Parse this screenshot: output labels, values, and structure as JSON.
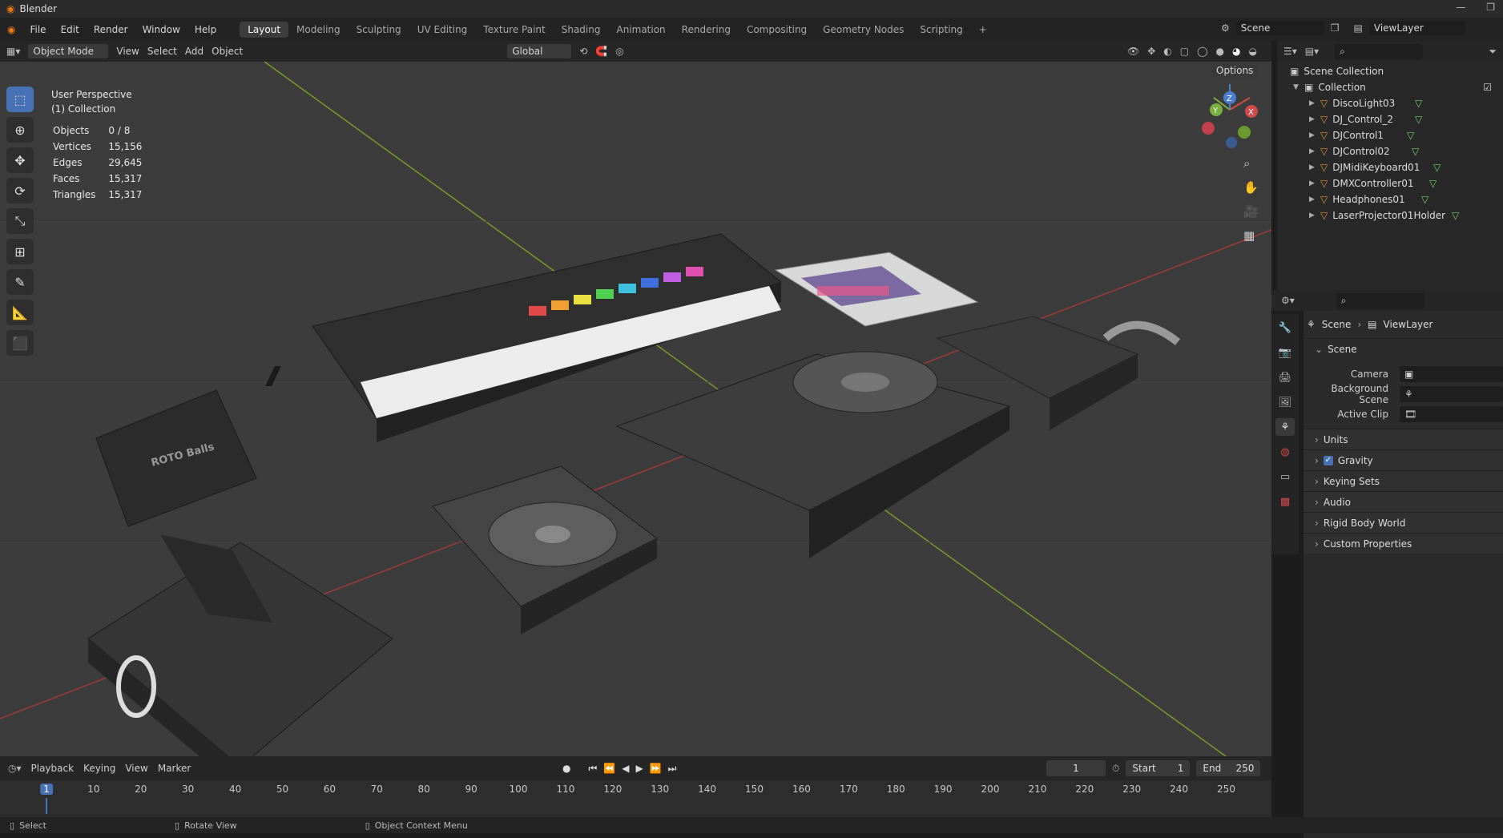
{
  "window": {
    "title": "Blender"
  },
  "menu": [
    "File",
    "Edit",
    "Render",
    "Window",
    "Help"
  ],
  "workspaces": [
    "Layout",
    "Modeling",
    "Sculpting",
    "UV Editing",
    "Texture Paint",
    "Shading",
    "Animation",
    "Rendering",
    "Compositing",
    "Geometry Nodes",
    "Scripting"
  ],
  "active_workspace": "Layout",
  "scene_field": "Scene",
  "viewlayer_field": "ViewLayer",
  "viewport_header": {
    "mode": "Object Mode",
    "view": "View",
    "select": "Select",
    "add": "Add",
    "object": "Object",
    "orientation": "Global",
    "options": "Options"
  },
  "overlay": {
    "perspective": "User Perspective",
    "collection": "(1) Collection"
  },
  "stats": [
    {
      "label": "Objects",
      "value": "0 / 8"
    },
    {
      "label": "Vertices",
      "value": "15,156"
    },
    {
      "label": "Edges",
      "value": "29,645"
    },
    {
      "label": "Faces",
      "value": "15,317"
    },
    {
      "label": "Triangles",
      "value": "15,317"
    }
  ],
  "scene_label": "ROTO Balls",
  "outliner": {
    "scene_collection": "Scene Collection",
    "collection": "Collection",
    "items": [
      "DiscoLight03",
      "DJ_Control_2",
      "DJControl1",
      "DJControl02",
      "DJMidiKeyboard01",
      "DMXController01",
      "Headphones01",
      "LaserProjector01Holder"
    ]
  },
  "properties": {
    "breadcrumb_scene": "Scene",
    "breadcrumb_viewlayer": "ViewLayer",
    "panel": "Scene",
    "fields": [
      {
        "label": "Camera"
      },
      {
        "label": "Background Scene"
      },
      {
        "label": "Active Clip"
      }
    ],
    "sections": [
      "Units",
      "Gravity",
      "Keying Sets",
      "Audio",
      "Rigid Body World",
      "Custom Properties"
    ],
    "gravity_checked": true
  },
  "timeline": {
    "playback": "Playback",
    "keying": "Keying",
    "view": "View",
    "marker": "Marker",
    "current_frame": "1",
    "start_label": "Start",
    "start": "1",
    "end_label": "End",
    "end": "250",
    "ticks": [
      "1",
      "10",
      "20",
      "30",
      "40",
      "50",
      "60",
      "70",
      "80",
      "90",
      "100",
      "110",
      "120",
      "130",
      "140",
      "150",
      "160",
      "170",
      "180",
      "190",
      "200",
      "210",
      "220",
      "230",
      "240",
      "250"
    ]
  },
  "status": {
    "select": "Select",
    "rotate": "Rotate View",
    "context": "Object Context Menu"
  }
}
